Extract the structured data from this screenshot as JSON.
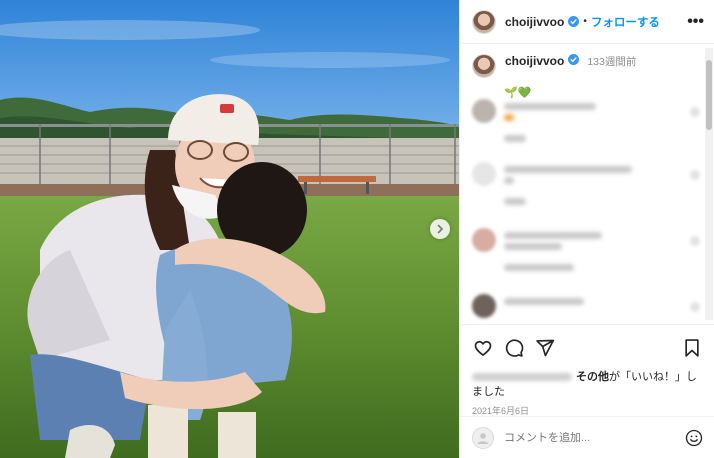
{
  "post": {
    "username": "choijivvoo",
    "follow_label": "フォローする",
    "separator": "•",
    "more_label": "•••",
    "caption_time": "133週間前",
    "caption_emoji": "🌱💚",
    "likes_text_bold": "その他",
    "likes_text_rest": "が「いいね！」しました",
    "date": "2021年6月6日",
    "comment_placeholder": "コメントを追加..."
  },
  "colors": {
    "follow_blue": "#0095f6",
    "verified_blue": "#3897f0",
    "muted_gray": "#8e8e8e"
  },
  "icons": [
    "verified-badge-icon",
    "more-icon",
    "heart-icon",
    "comment-icon",
    "share-icon",
    "bookmark-icon",
    "emoji-icon",
    "chevron-right-icon"
  ]
}
